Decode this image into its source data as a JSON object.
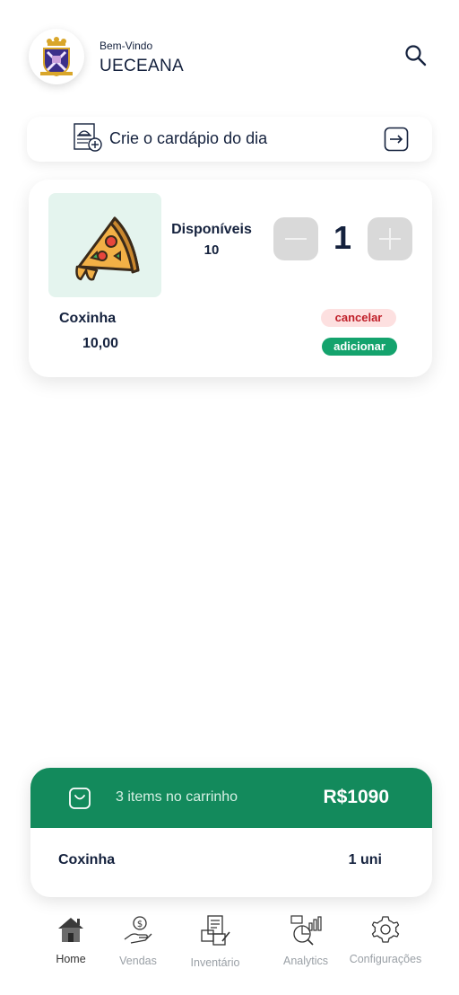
{
  "header": {
    "greeting": "Bem-Vindo",
    "user_name": "UECEANA",
    "search_icon": "search-icon"
  },
  "menu_card": {
    "label": "Crie o cardápio do dia",
    "icon": "menu-document-add-icon",
    "action_icon": "arrow-right-box-icon"
  },
  "item_card": {
    "name": "Coxinha",
    "price": "10,00",
    "available_label": "Disponíveis",
    "available_value": "10",
    "quantity": "1",
    "cancel_label": "cancelar",
    "add_label": "adicionar",
    "image_icon": "pizza-slice-icon"
  },
  "cart": {
    "summary": "3 items no carrinho",
    "total": "R$1090",
    "items": [
      {
        "name": "Coxinha",
        "qty": "1 uni"
      }
    ]
  },
  "nav": {
    "items": [
      {
        "label": "Home",
        "icon": "home-icon"
      },
      {
        "label": "Vendas",
        "icon": "hand-money-icon"
      },
      {
        "label": "Inventário",
        "icon": "inventory-icon"
      },
      {
        "label": "Analytics",
        "icon": "analytics-icon"
      },
      {
        "label": "Configurações",
        "icon": "gear-icon"
      }
    ]
  },
  "colors": {
    "primary_green": "#138a5c",
    "add_green": "#14a36d",
    "cancel_red": "#c0202a",
    "text_navy": "#14213d",
    "thumb_bg": "#e4f4ee"
  }
}
